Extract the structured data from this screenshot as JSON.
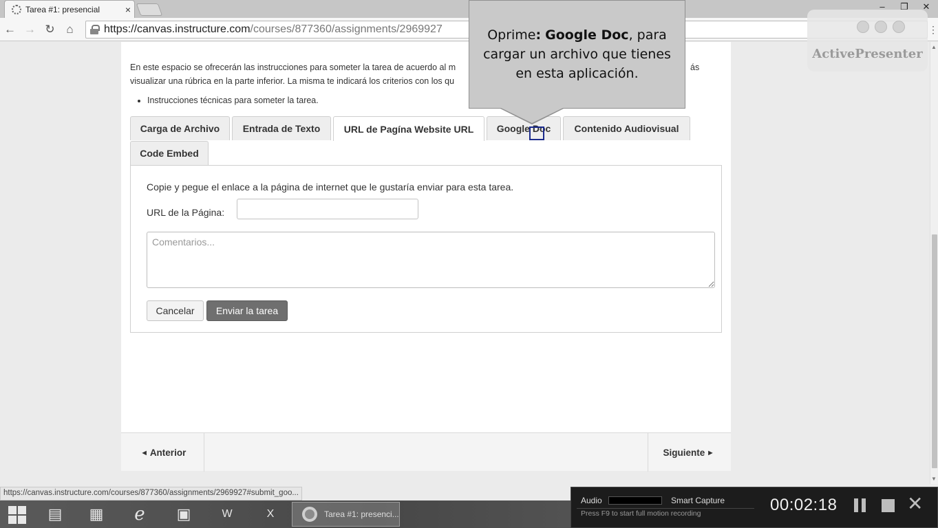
{
  "browser": {
    "tab_title": "Tarea #1: presencial",
    "tab_close": "×",
    "url_host": "https://canvas.instructure.com",
    "url_path": "/courses/877360/assignments/2969927",
    "window_controls": [
      "–",
      "❐",
      "✕"
    ],
    "status_url": "https://canvas.instructure.com/courses/877360/assignments/2969927#submit_goo..."
  },
  "page": {
    "instructions": "En este espacio se ofrecerán las instrucciones para someter la tarea de acuerdo al m... visualizar una rúbrica en la parte inferior. La misma te indicará los criterios con los qu...",
    "instructions_line1": "En este espacio se ofrecerán las instrucciones para someter la tarea de acuerdo al m",
    "instructions_line1_end": "ás",
    "instructions_line2": "visualizar una rúbrica en la parte inferior. La misma te indicará los criterios con los qu",
    "bullet": "Instrucciones técnicas para someter la tarea.",
    "tabs": [
      {
        "label": "Carga de Archivo",
        "active": false
      },
      {
        "label": "Entrada de Texto",
        "active": false
      },
      {
        "label": "URL de Pagína Website URL",
        "active": true
      },
      {
        "label": "Google Doc",
        "active": false
      },
      {
        "label": "Contenido Audiovisual",
        "active": false
      },
      {
        "label": "Code Embed",
        "active": false
      }
    ],
    "panel": {
      "description": "Copie y pegue el enlace a la página de internet que le gustaría enviar para esta tarea.",
      "url_label": "URL de la Página:",
      "url_value": "",
      "comments_placeholder": "Comentarios...",
      "cancel_label": "Cancelar",
      "submit_label": "Enviar la tarea"
    },
    "pager": {
      "prev_label": "Anterior",
      "next_label": "Siguiente"
    }
  },
  "callout": {
    "prefix": "Oprime",
    "colon": ":",
    "bold": "Google Doc",
    "suffix": ",  para cargar un archivo que tienes en esta aplicación."
  },
  "watermark": {
    "text": "ActivePresenter"
  },
  "taskbar": {
    "chrome_label": "Tarea #1: presenci...",
    "word_label": "W",
    "excel_label": "X"
  },
  "recorder": {
    "audio_label": "Audio",
    "mode": "Smart Capture",
    "hint": "Press F9 to start full motion recording",
    "time": "00:02:18"
  },
  "colors": {
    "submit_button": "#6f6f6f",
    "callout_bg": "#c9c9c9",
    "click_marker": "#1a2a8c"
  }
}
